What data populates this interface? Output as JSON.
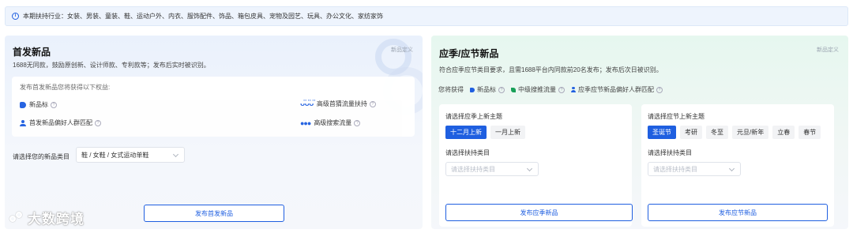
{
  "notice": {
    "text": "本期扶持行业：女装、男装、童装、鞋、运动户外、内衣、服饰配件、饰品、箱包皮具、宠物及园艺、玩具、办公文化、家纺家饰"
  },
  "first_release": {
    "title": "首发新品",
    "subtitle": "1688无同款，鼓励原创新、设计师款、专利款等；发布后实时被识别。",
    "definition_link": "新品定义",
    "benefits_heading": "发布首发新品您将获得以下权益:",
    "benefits": [
      {
        "icon": "tag-icon",
        "label": "新品标"
      },
      {
        "icon": "user-icon",
        "label": "首发新品偏好人群匹配"
      },
      {
        "icon": "group-icon",
        "label": "高级首猜流量扶持"
      },
      {
        "icon": "drops-icon",
        "label": "高级搜索流量"
      }
    ],
    "category_label": "请选择您的新品类目",
    "category_value": "鞋 / 女鞋 / 女式运动单鞋",
    "button_label": "发布首发新品"
  },
  "season_release": {
    "title": "应季/应节新品",
    "subtitle": "符合应季应节类目要求，且需1688平台内同款前20名发布；发布后次日被识别。",
    "definition_link": "新品定义",
    "perks_prefix": "您将获得",
    "perks": [
      {
        "icon": "tag-icon",
        "label": "新品标"
      },
      {
        "icon": "leaf-icon",
        "label": "中级搜推流量"
      },
      {
        "icon": "user-icon",
        "label": "应季应节新品偏好人群匹配"
      }
    ],
    "season_panel": {
      "theme_label": "请选择应季上新主题",
      "chips": [
        {
          "label": "十二月上新",
          "active": true
        },
        {
          "label": "一月上新",
          "active": false
        }
      ],
      "category_label": "请选择扶持类目",
      "category_placeholder": "请选择扶持类目",
      "button_label": "发布应季新品"
    },
    "festival_panel": {
      "theme_label": "请选择应节上新主题",
      "chips": [
        {
          "label": "圣诞节",
          "active": true
        },
        {
          "label": "考研",
          "active": false
        },
        {
          "label": "冬至",
          "active": false
        },
        {
          "label": "元旦/新年",
          "active": false
        },
        {
          "label": "立春",
          "active": false
        },
        {
          "label": "春节",
          "active": false
        }
      ],
      "category_label": "请选择扶持类目",
      "category_placeholder": "请选择扶持类目",
      "button_label": "发布应节新品"
    }
  },
  "watermark": "大数跨境",
  "colors": {
    "primary": "#1f5fe0",
    "green": "#18a058",
    "notice_bg": "#eef4fd"
  }
}
